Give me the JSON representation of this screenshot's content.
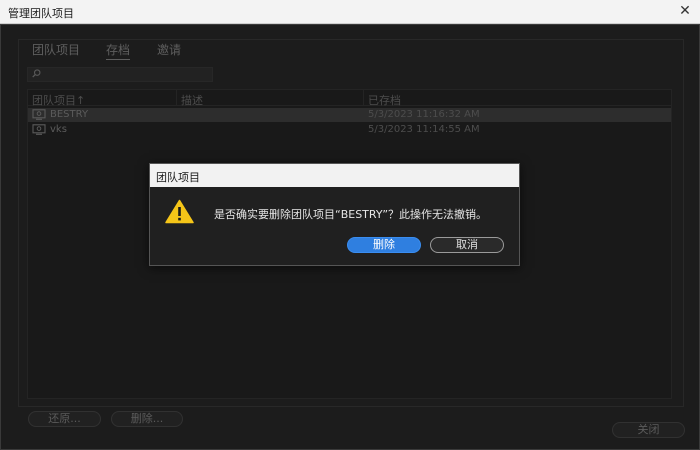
{
  "window": {
    "title": "管理团队项目",
    "close_glyph": "✕"
  },
  "tabs": [
    {
      "label": "团队项目",
      "active": false
    },
    {
      "label": "存档",
      "active": true
    },
    {
      "label": "邀请",
      "active": false
    }
  ],
  "search": {
    "placeholder": "",
    "icon": "search-icon"
  },
  "table": {
    "headers": [
      "团队项目",
      "描述",
      "已存档"
    ],
    "sort_indicator": "↑",
    "rows": [
      {
        "name": "BESTRY",
        "description": "",
        "archived": "5/3/2023 11:16:32 AM",
        "selected": true
      },
      {
        "name": "vks",
        "description": "",
        "archived": "5/3/2023 11:14:55 AM",
        "selected": false
      }
    ]
  },
  "bottom_buttons": {
    "restore": "还原...",
    "delete": "删除...",
    "close": "关闭"
  },
  "dialog": {
    "title": "团队项目",
    "message": "是否确实要删除团队项目“BESTRY”？此操作无法撤销。",
    "confirm": "删除",
    "cancel": "取消",
    "icon": "warning-icon"
  },
  "colors": {
    "accent": "#2f7fe0",
    "warning": "#f5c518",
    "background": "#1c1c1c"
  }
}
